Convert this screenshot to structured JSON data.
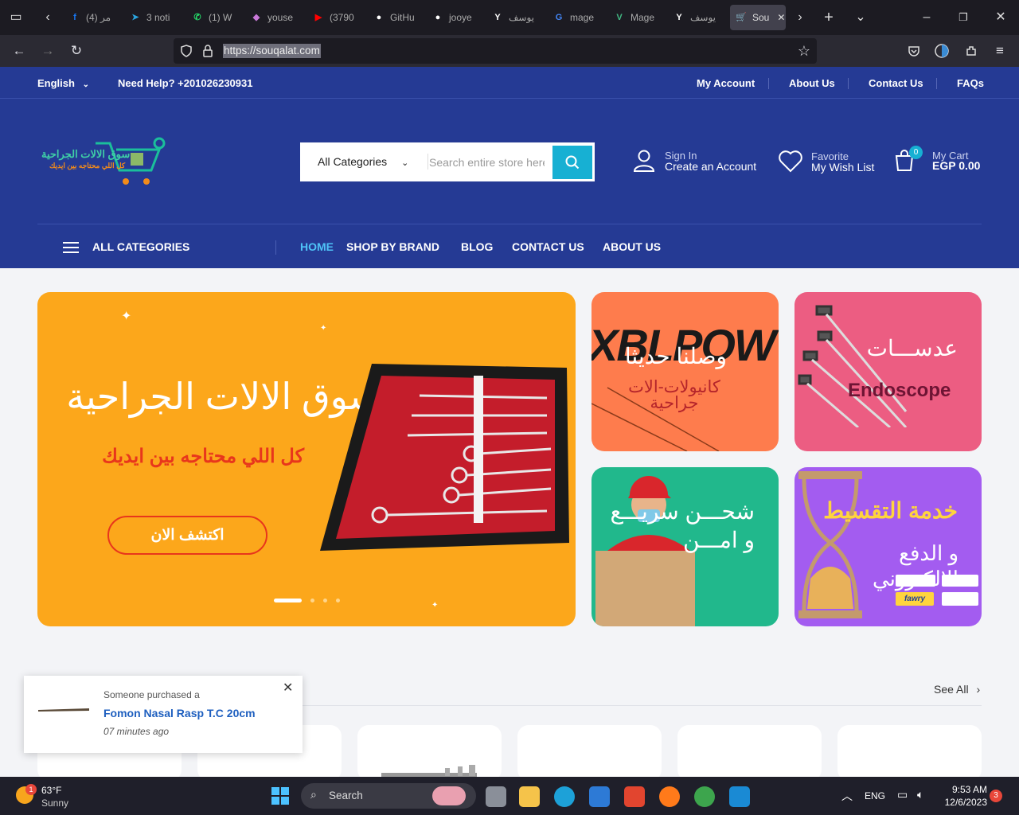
{
  "browser": {
    "tabs": [
      {
        "label": "(4) مر",
        "icon": "facebook-icon",
        "color": "#1877f2"
      },
      {
        "label": "3 noti",
        "icon": "telegram-icon",
        "color": "#2aa3dd"
      },
      {
        "label": "(1) W",
        "icon": "whatsapp-icon",
        "color": "#25d366"
      },
      {
        "label": "youse",
        "icon": "app-icon",
        "color": "#c878d8"
      },
      {
        "label": "(3790",
        "icon": "youtube-icon",
        "color": "#ff0000"
      },
      {
        "label": "GitHu",
        "icon": "github-icon",
        "color": "#ffffff"
      },
      {
        "label": "jooye",
        "icon": "github-icon",
        "color": "#ffffff"
      },
      {
        "label": "يوسف",
        "icon": "y-icon",
        "color": "#ffffff"
      },
      {
        "label": "mage",
        "icon": "google-icon",
        "color": "#4285f4"
      },
      {
        "label": "Mage",
        "icon": "vue-icon",
        "color": "#41b883"
      },
      {
        "label": "يوسف",
        "icon": "y-icon",
        "color": "#ffffff"
      },
      {
        "label": "Sou",
        "icon": "cart-icon",
        "color": "#17b0d3",
        "active": true
      }
    ],
    "url": "https://souqalat.com"
  },
  "topbar": {
    "language": "English",
    "help": "Need Help? +201026230931",
    "links": [
      "My Account",
      "About Us",
      "Contact Us",
      "FAQs"
    ]
  },
  "header": {
    "logo_text": "سوق الالات الجراحية",
    "logo_sub": "كل اللي محتاجه بين ايديك",
    "search": {
      "category": "All Categories",
      "placeholder": "Search entire store here..."
    },
    "account": {
      "label": "Sign In",
      "value": "Create an Account"
    },
    "wishlist": {
      "label": "Favorite",
      "value": "My Wish List"
    },
    "cart": {
      "label": "My Cart",
      "value": "EGP 0.00",
      "count": "0"
    }
  },
  "menu": {
    "all_categories": "ALL CATEGORIES",
    "items": [
      "HOME",
      "SHOP BY BRAND",
      "BLOG",
      "CONTACT US",
      "ABOUT US"
    ]
  },
  "hero": {
    "title": "سوق الالات الجراحية",
    "subtitle": "كل اللي محتاجه بين ايديك",
    "button": "اكتشف الان"
  },
  "promos": {
    "p1_brand": "BLPOW",
    "p1_title": "وصلنا حديثا",
    "p1_sub": "كانيولات-الات جراحية",
    "p2_title": "عدســـات",
    "p2_sub": "Endoscope",
    "p3_title": "شحـــن سريـــع و امـــن",
    "p4_title": "خدمة التقسيط",
    "p4_sub": "و الدفع الالكتروني",
    "p4_badge": "fawry"
  },
  "section": {
    "see_all": "See All"
  },
  "popup": {
    "line1": "Someone purchased a",
    "product": "Fomon Nasal Rasp T.C 20cm",
    "time": "07 minutes ago"
  },
  "taskbar": {
    "weather_temp": "63°F",
    "weather_desc": "Sunny",
    "weather_badge": "1",
    "search": "Search",
    "lang": "ENG",
    "time": "9:53 AM",
    "date": "12/6/2023",
    "notif": "3"
  }
}
